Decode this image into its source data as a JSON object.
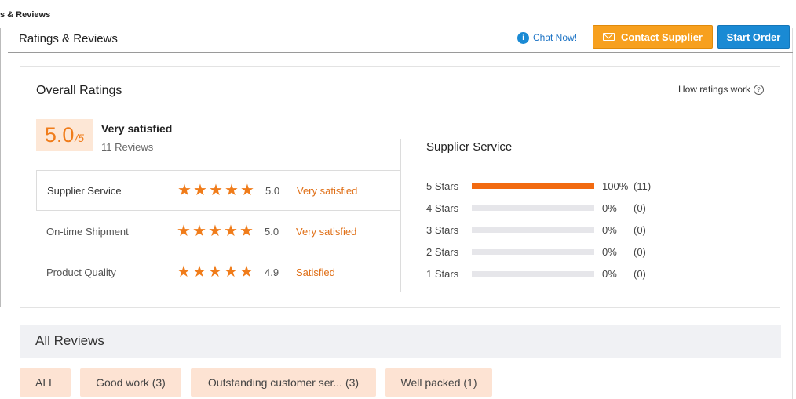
{
  "breadcrumb": "s & Reviews",
  "page_title": "Ratings & Reviews",
  "header": {
    "chat_label": "Chat Now!",
    "chat_icon_glyph": "i",
    "contact_label": "Contact Supplier",
    "start_order_label": "Start Order"
  },
  "overall": {
    "title": "Overall Ratings",
    "how_ratings_label": "How ratings work",
    "help_glyph": "?",
    "score": "5.0",
    "out_of": "/5",
    "level": "Very satisfied",
    "reviews_count_text": "11 Reviews",
    "categories": [
      {
        "name": "Supplier Service",
        "stars": 5,
        "score": "5.0",
        "level": "Very satisfied"
      },
      {
        "name": "On-time Shipment",
        "stars": 5,
        "score": "5.0",
        "level": "Very satisfied"
      },
      {
        "name": "Product Quality",
        "stars": 5,
        "score": "4.9",
        "level": "Satisfied"
      }
    ]
  },
  "distribution": {
    "title": "Supplier Service",
    "rows": [
      {
        "label": "5 Stars",
        "fraction": 1.0,
        "pct": "100%",
        "count": "(11)"
      },
      {
        "label": "4 Stars",
        "fraction": 0,
        "pct": "0%",
        "count": "(0)"
      },
      {
        "label": "3 Stars",
        "fraction": 0,
        "pct": "0%",
        "count": "(0)"
      },
      {
        "label": "2 Stars",
        "fraction": 0,
        "pct": "0%",
        "count": "(0)"
      },
      {
        "label": "1 Stars",
        "fraction": 0,
        "pct": "0%",
        "count": "(0)"
      }
    ]
  },
  "all_reviews": {
    "title": "All Reviews",
    "filters": [
      "ALL",
      "Good work (3)",
      "Outstanding customer ser... (3)",
      "Well packed (1)"
    ]
  },
  "colors": {
    "accent_orange": "#f07c1a",
    "bar_orange": "#f26a10",
    "contact_button": "#f7a01e",
    "start_button": "#1a8ad4"
  },
  "icons": {
    "chat": "chat-bubble-icon",
    "mail": "mail-icon",
    "help": "question-circle-icon",
    "star": "star-icon"
  }
}
